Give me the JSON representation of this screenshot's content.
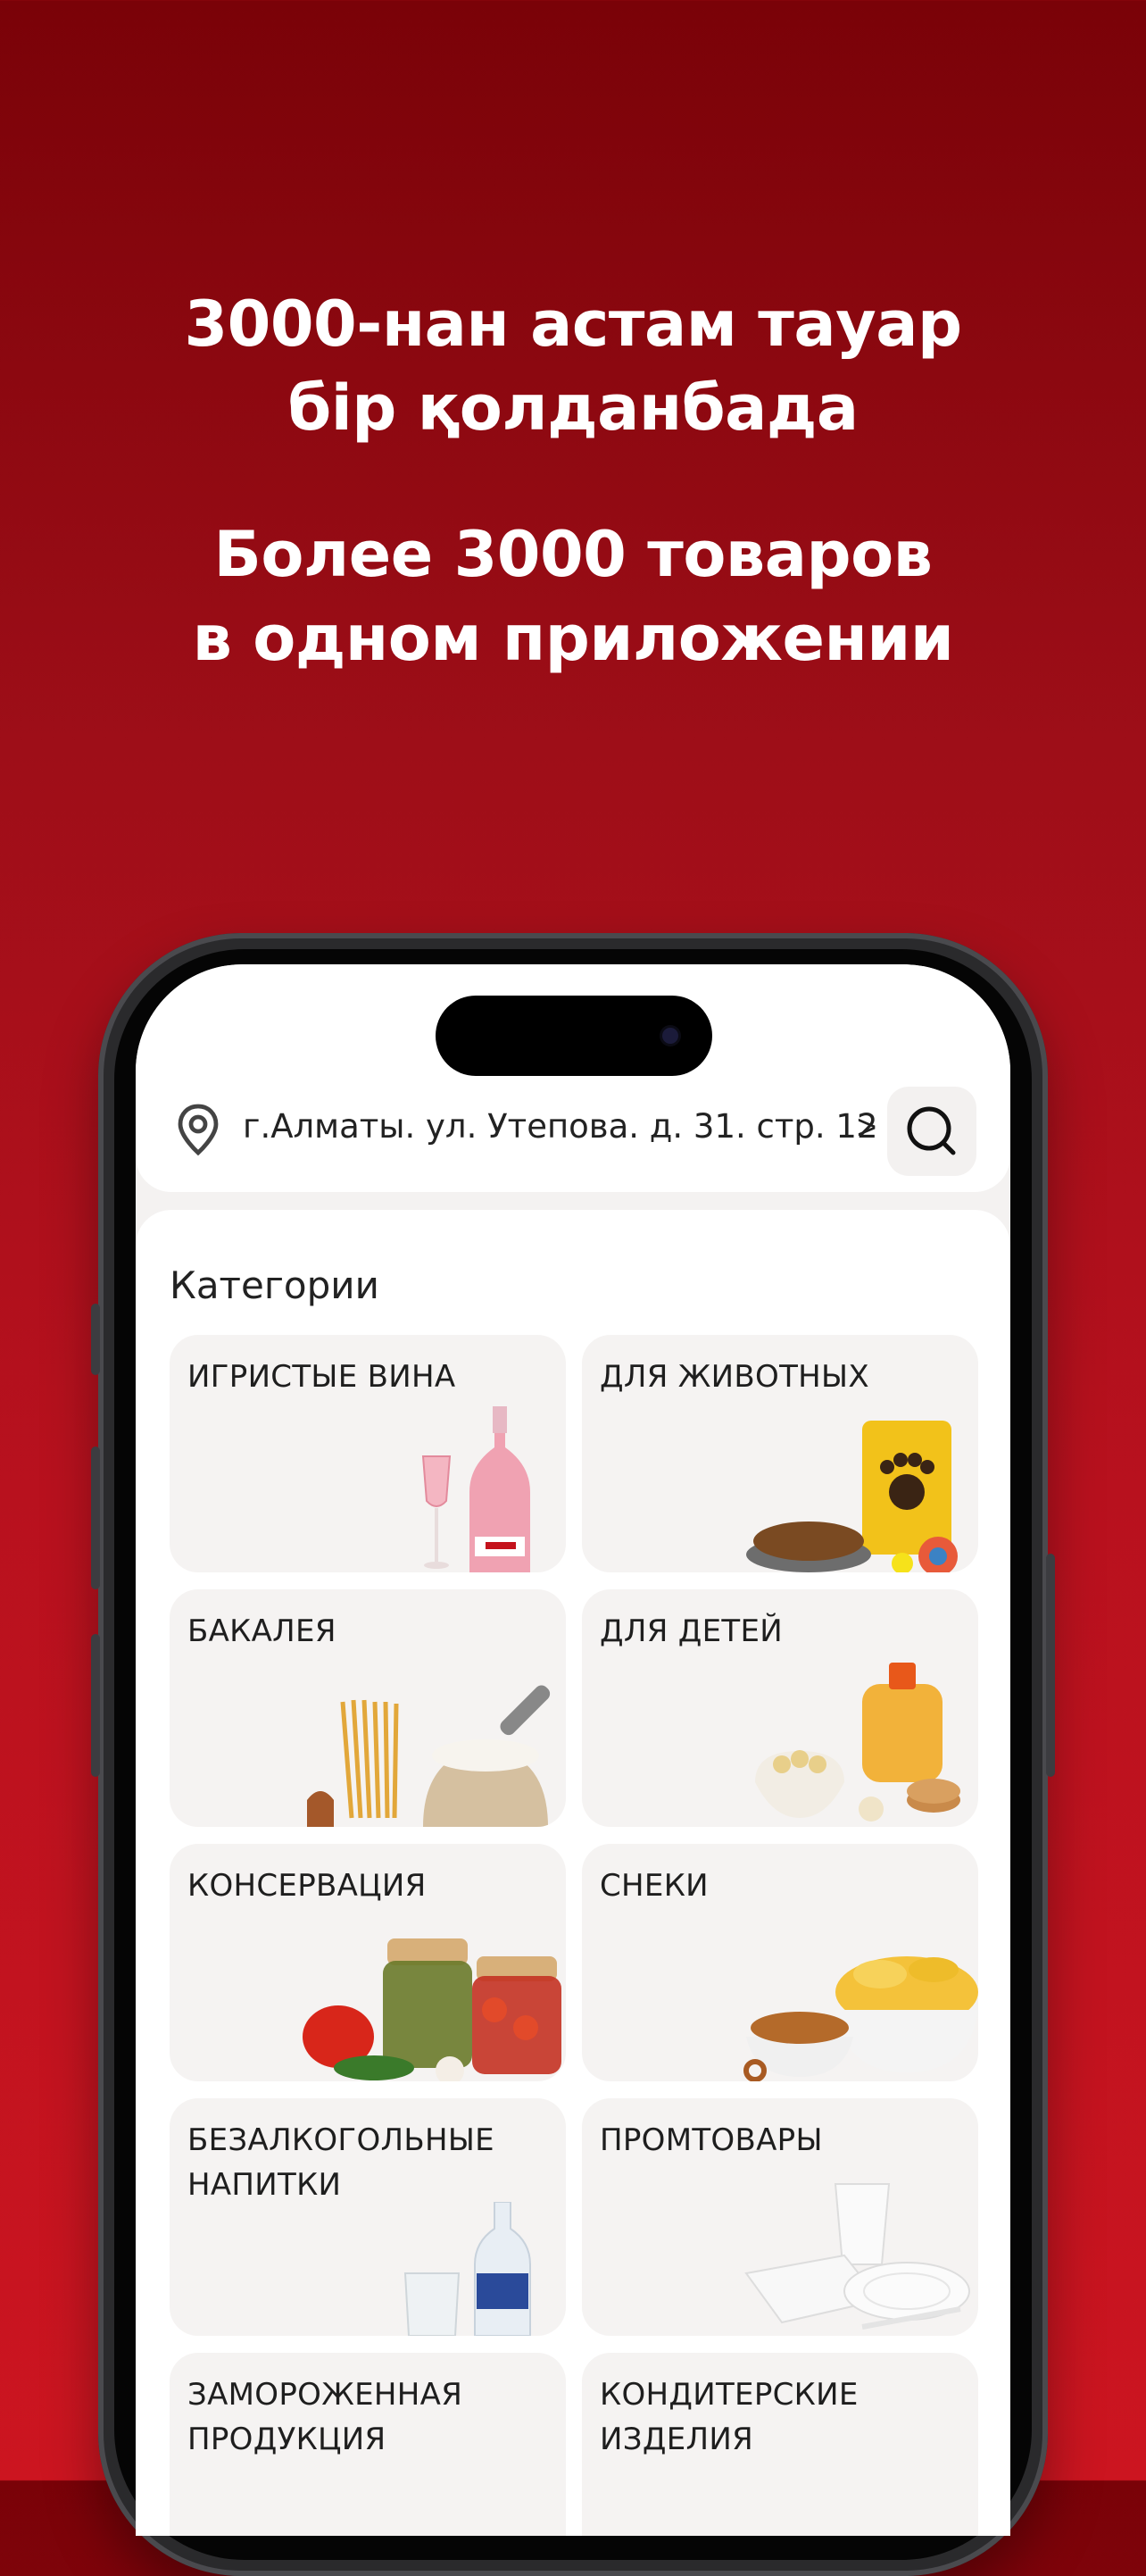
{
  "headline_kz": [
    "3000-нан астам тауар",
    "бір қолданбада"
  ],
  "headline_ru": [
    "Более 3000 товаров",
    "в одном приложении"
  ],
  "app": {
    "address": "г.Алматы. ул. Утепова. д. 31. стр. 12",
    "address_chevron": ">",
    "categories_title": "Категории",
    "categories": [
      {
        "label": "ИГРИСТЫЕ ВИНА",
        "icon": "sparkling-wine-image"
      },
      {
        "label": "ДЛЯ ЖИВОТНЫХ",
        "icon": "pet-food-image"
      },
      {
        "label": "БАКАЛЕЯ",
        "icon": "grocery-image"
      },
      {
        "label": "ДЛЯ ДЕТЕЙ",
        "icon": "kids-food-image"
      },
      {
        "label": "КОНСЕРВАЦИЯ",
        "icon": "canned-food-image"
      },
      {
        "label": "СНЕКИ",
        "icon": "snacks-image"
      },
      {
        "label": "БЕЗАЛКОГОЛЬНЫЕ НАПИТКИ",
        "icon": "soft-drinks-image"
      },
      {
        "label": "ПРОМТОВАРЫ",
        "icon": "household-goods-image"
      },
      {
        "label": "ЗАМОРОЖЕННАЯ ПРОДУКЦИЯ",
        "icon": "frozen-food-image"
      },
      {
        "label": "КОНДИТЕРСКИЕ ИЗДЕЛИЯ",
        "icon": "confectionery-image"
      }
    ]
  },
  "colors": {
    "brand_red": "#c4121c",
    "card_bg": "#f5f3f2"
  }
}
